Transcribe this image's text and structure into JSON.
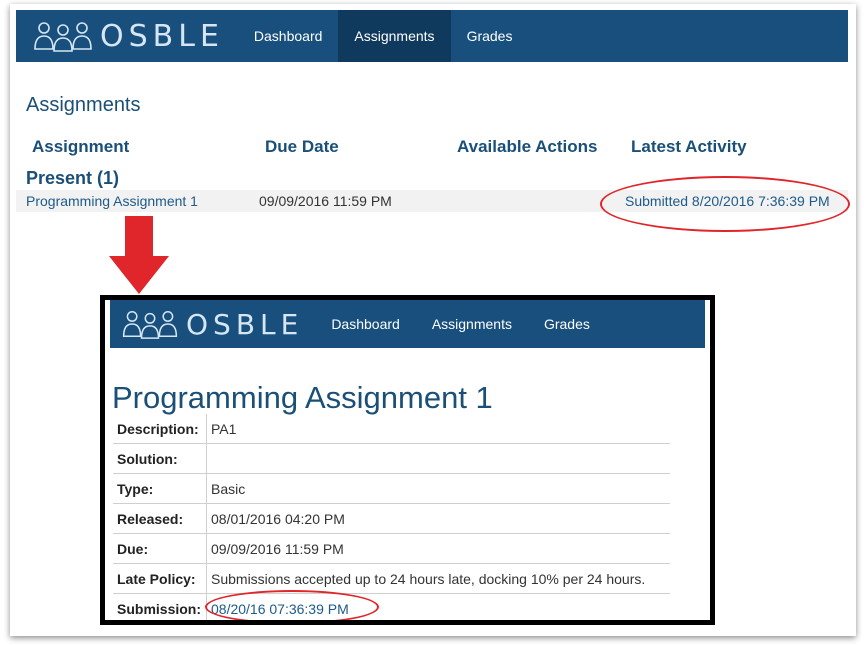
{
  "brand": {
    "name": "OSBLE"
  },
  "nav": {
    "dashboard": "Dashboard",
    "assignments": "Assignments",
    "grades": "Grades"
  },
  "colors": {
    "navbar": "#184f7c",
    "nav_active": "#0f3a5d",
    "accent_text": "#1a4f78",
    "link": "#1e5a8a",
    "annotation_red": "#e0262b"
  },
  "assignments_page": {
    "title": "Assignments",
    "columns": [
      "Assignment",
      "Due Date",
      "Available Actions",
      "Latest Activity"
    ],
    "group": "Present (1)",
    "rows": [
      {
        "assignment": "Programming Assignment 1",
        "due_date": "09/09/2016 11:59 PM",
        "latest_activity": "Submitted 8/20/2016 7:36:39 PM"
      }
    ]
  },
  "detail_page": {
    "title": "Programming Assignment 1",
    "fields": [
      {
        "label": "Description:",
        "value": "PA1"
      },
      {
        "label": "Solution:",
        "value": ""
      },
      {
        "label": "Type:",
        "value": "Basic"
      },
      {
        "label": "Released:",
        "value": "08/01/2016 04:20 PM"
      },
      {
        "label": "Due:",
        "value": "09/09/2016 11:59 PM"
      },
      {
        "label": "Late Policy:",
        "value": "Submissions accepted up to 24 hours late, docking 10% per 24 hours."
      },
      {
        "label": "Submission:",
        "value": "08/20/16 07:36:39 PM"
      }
    ]
  },
  "icons": {
    "logo": "people-group-logo-icon",
    "arrow": "arrow-down-icon"
  }
}
